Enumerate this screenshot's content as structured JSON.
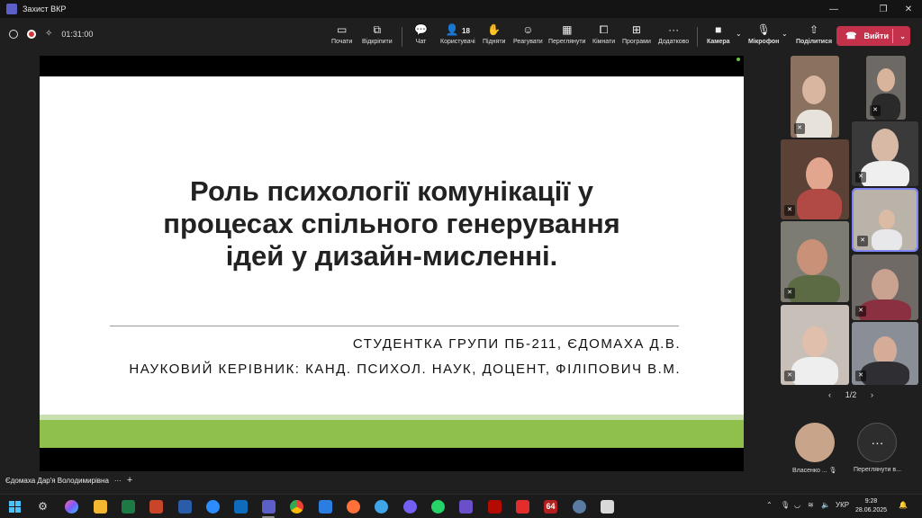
{
  "window": {
    "title": "Захист ВКР",
    "minimize": "—",
    "restore": "❐",
    "close": "✕"
  },
  "toolbar": {
    "timer": "01:31:00",
    "buttons": {
      "start": "Почати",
      "pin": "Відкріпити",
      "chat": "Чат",
      "people": "Користувачі",
      "people_count": "18",
      "raise": "Підняти",
      "react": "Реагувати",
      "view": "Переглянути",
      "rooms": "Кімнати",
      "apps": "Програми",
      "more": "Додатково",
      "camera": "Камера",
      "mic": "Мікрофон",
      "share": "Поділитися"
    },
    "leave_label": "Вийти"
  },
  "slide": {
    "title_line1": "Роль психології комунікації у",
    "title_line2": "процесах спільного генерування",
    "title_line3": "ідей у дизайн-мисленні.",
    "author": "СТУДЕНТКА ГРУПИ ПБ-211, ЄДОМАХА Д.В.",
    "advisor": "НАУКОВИЙ КЕРІВНИК: КАНД. ПСИХОЛ. НАУК, ДОЦЕНТ, ФІЛІПОВИЧ В.М.",
    "accent_color": "#8fc04c"
  },
  "presenter": {
    "name": "Єдомаха Дар'я Володимирівна",
    "more": "···",
    "add": "+"
  },
  "gallery": {
    "page": "1/2",
    "prev": "‹",
    "next": "›",
    "bottom_participant": "Власенко ...",
    "overflow_label": "Переглянути в..."
  },
  "taskbar": {
    "time": "9:28",
    "date": "28.06.2025",
    "lang": "УКР",
    "badge_64": "64"
  }
}
